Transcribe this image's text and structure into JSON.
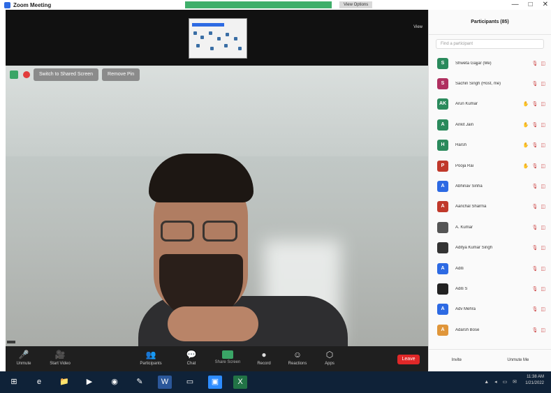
{
  "window": {
    "title": "Zoom Meeting",
    "view_button": "View Options",
    "controls": [
      "—",
      "□",
      "✕"
    ]
  },
  "gallery": {
    "view_label": "View"
  },
  "video": {
    "switch_pill": "Switch to Shared Screen",
    "remove_pin": "Remove Pin",
    "name_tag": ""
  },
  "toolbar": {
    "buttons": [
      {
        "icon": "microphone-icon",
        "glyph": "🎤",
        "label": "Unmute"
      },
      {
        "icon": "video-camera-icon",
        "glyph": "🎥",
        "label": "Start Video"
      },
      {
        "icon": "participants-icon",
        "glyph": "👥",
        "label": "Participants"
      },
      {
        "icon": "chat-icon",
        "glyph": "💬",
        "label": "Chat"
      },
      {
        "icon": "share-screen-icon",
        "glyph": "",
        "label": "Share Screen"
      },
      {
        "icon": "record-icon",
        "glyph": "●",
        "label": "Record"
      },
      {
        "icon": "reactions-icon",
        "glyph": "☺",
        "label": "Reactions"
      },
      {
        "icon": "apps-icon",
        "glyph": "⬡",
        "label": "Apps"
      }
    ],
    "leave": "Leave"
  },
  "panel": {
    "title": "Participants (85)",
    "search_placeholder": "Find a participant",
    "participants": [
      {
        "initial": "S",
        "color": "#2a8a5c",
        "name": "Shweta Gajjar (Me)",
        "hand": false
      },
      {
        "initial": "S",
        "color": "#b03060",
        "name": "Sachin Singh (Host, me)",
        "hand": false
      },
      {
        "initial": "AK",
        "color": "#2a8a5c",
        "name": "Arun Kumar",
        "hand": true
      },
      {
        "initial": "A",
        "color": "#2a8a5c",
        "name": "Ankit Jain",
        "hand": true
      },
      {
        "initial": "H",
        "color": "#2a8a5c",
        "name": "Harsh",
        "hand": true
      },
      {
        "initial": "P",
        "color": "#c0392b",
        "name": "Pooja Rai",
        "hand": true
      },
      {
        "initial": "A",
        "color": "#2d6ae3",
        "name": "Abhinav Sinha",
        "hand": false
      },
      {
        "initial": "A",
        "color": "#c0392b",
        "name": "Aanchal Sharma",
        "hand": false
      },
      {
        "initial": "",
        "color": "#555555",
        "name": "A. Kumar",
        "hand": false
      },
      {
        "initial": "",
        "color": "#333333",
        "name": "Aditya Kumar Singh",
        "hand": false
      },
      {
        "initial": "A",
        "color": "#2d6ae3",
        "name": "Aditi",
        "hand": false
      },
      {
        "initial": "",
        "color": "#222222",
        "name": "Aditi S",
        "hand": false
      },
      {
        "initial": "A",
        "color": "#2d6ae3",
        "name": "Adv Mehra",
        "hand": false
      },
      {
        "initial": "A",
        "color": "#e0963a",
        "name": "Adarsh Bose",
        "hand": false
      }
    ],
    "invite": "Invite",
    "unmute_me": "Unmute Me"
  },
  "taskbar": {
    "apps": [
      {
        "icon": "windows-start-icon",
        "glyph": "⊞",
        "color": "#0f2238"
      },
      {
        "icon": "internet-explorer-icon",
        "glyph": "e",
        "color": "#0f2238"
      },
      {
        "icon": "file-explorer-icon",
        "glyph": "📁",
        "color": "#0f2238"
      },
      {
        "icon": "media-player-icon",
        "glyph": "▶",
        "color": "#0f2238"
      },
      {
        "icon": "chrome-icon",
        "glyph": "◉",
        "color": "#0f2238"
      },
      {
        "icon": "paint-icon",
        "glyph": "✎",
        "color": "#0f2238"
      },
      {
        "icon": "word-icon",
        "glyph": "W",
        "color": "#2b579a"
      },
      {
        "icon": "monitor-icon",
        "glyph": "▭",
        "color": "#0f2238"
      },
      {
        "icon": "zoom-icon",
        "glyph": "▣",
        "color": "#2d8cff"
      },
      {
        "icon": "excel-icon",
        "glyph": "X",
        "color": "#217346"
      }
    ],
    "time": "11:38 AM",
    "date": "1/21/2022"
  }
}
